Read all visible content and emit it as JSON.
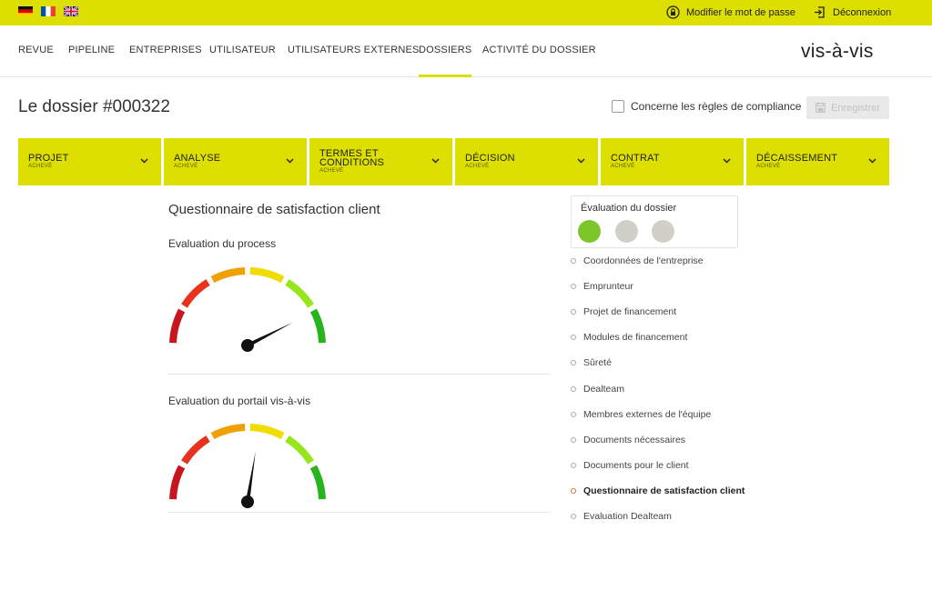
{
  "topbar": {
    "languages": [
      "Deutsch",
      "Français",
      "English"
    ],
    "change_password": "Modifier le mot de passe",
    "logout": "Déconnexion"
  },
  "nav": {
    "items": [
      "REVUE",
      "PIPELINE",
      "ENTREPRISES",
      "UTILISATEUR",
      "UTILISATEURS EXTERNES",
      "DOSSIERS",
      "ACTIVITÉ DU DOSSIER"
    ],
    "active": "DOSSIERS",
    "logo": "VIS-À-VIS"
  },
  "page": {
    "title": "Le dossier #000322",
    "compliance_label": "Concerne les règles de compliance",
    "save_label": "Enregistrer"
  },
  "steps": [
    {
      "title": "PROJET",
      "status": "ACHEVÉ"
    },
    {
      "title": "ANALYSE",
      "status": "ACHEVÉ"
    },
    {
      "title": "TERMES ET CONDITIONS",
      "status": "ACHEVÉ"
    },
    {
      "title": "DÉCISION",
      "status": "ACHEVÉ"
    },
    {
      "title": "CONTRAT",
      "status": "ACHEVÉ"
    },
    {
      "title": "DÉCAISSEMENT",
      "status": "ACHEVÉ"
    }
  ],
  "questionnaire": {
    "title": "Questionnaire de satisfaction client",
    "gauges": [
      {
        "label": "Evaluation du process",
        "value": 0.85
      },
      {
        "label": "Evaluation du portail vis-à-vis",
        "value": 0.55
      }
    ]
  },
  "evaluation": {
    "title": "Évaluation du dossier",
    "dots": [
      {
        "state": "active",
        "color": "#7dc62a"
      },
      {
        "state": "inactive",
        "color": "#d0d0c8"
      },
      {
        "state": "inactive",
        "color": "#d0d0c8"
      }
    ]
  },
  "sidebar": {
    "items": [
      "Coordonnées de l'entreprise",
      "Emprunteur",
      "Projet de financement",
      "Modules de financement",
      "Sûreté",
      "Dealteam",
      "Membres externes de l'équipe",
      "Documents nécessaires",
      "Documents pour le client",
      "Questionnaire de satisfaction client",
      "Evaluation Dealteam"
    ],
    "active_index": 9
  },
  "colors": {
    "accent": "#dcdf00",
    "gauge_segments": [
      "#c8141e",
      "#e8321e",
      "#f0a000",
      "#f0dc00",
      "#96e61e",
      "#28b41e"
    ]
  },
  "icons": {
    "change_password": "lock-icon",
    "logout": "logout-icon",
    "save": "save-icon",
    "step": "chevron-down-icon"
  }
}
